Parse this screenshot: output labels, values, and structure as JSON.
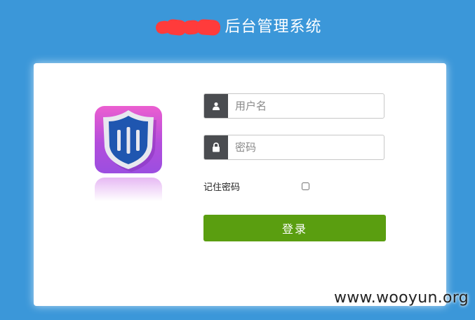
{
  "header": {
    "title": "后台管理系统"
  },
  "login": {
    "username_placeholder": "用户名",
    "password_placeholder": "密码",
    "remember_label": "记住密码",
    "remember_checked": false,
    "submit_label": "登录"
  },
  "icons": {
    "username": "user-icon",
    "password": "lock-icon",
    "logo": "shield-icon"
  },
  "colors": {
    "background": "#3b97d9",
    "card": "#ffffff",
    "addon": "#4a4c50",
    "button": "#5a9e10",
    "redaction": "#ff3b3b"
  },
  "watermark": "www.wooyun.org"
}
